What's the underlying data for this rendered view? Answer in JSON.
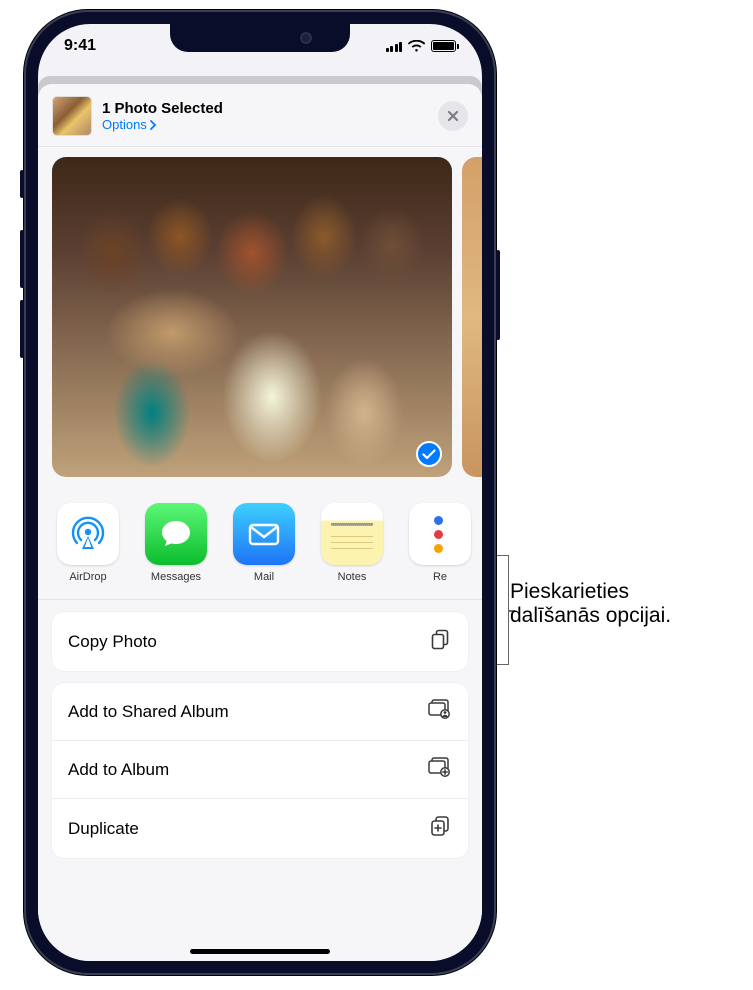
{
  "status": {
    "time": "9:41"
  },
  "header": {
    "title": "1 Photo Selected",
    "options_label": "Options"
  },
  "share_apps": [
    {
      "id": "airdrop",
      "label": "AirDrop"
    },
    {
      "id": "messages",
      "label": "Messages"
    },
    {
      "id": "mail",
      "label": "Mail"
    },
    {
      "id": "notes",
      "label": "Notes"
    },
    {
      "id": "reminders",
      "label": "Re"
    }
  ],
  "actions": {
    "copy": "Copy Photo",
    "shared_album": "Add to Shared Album",
    "album": "Add to Album",
    "duplicate": "Duplicate"
  },
  "callout": {
    "line1": "Pieskarieties",
    "line2": "dalīšanās opcijai."
  }
}
